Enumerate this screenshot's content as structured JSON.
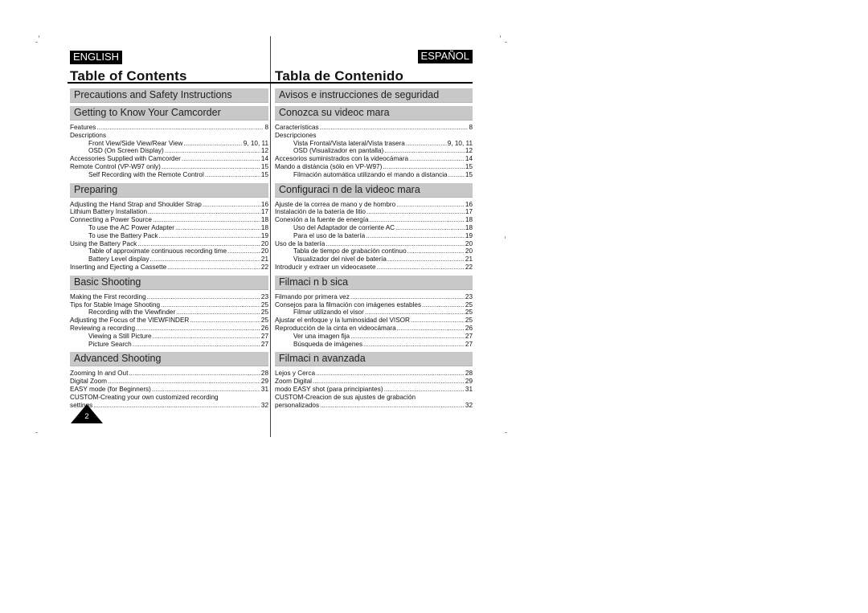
{
  "english": {
    "lang_label": "ENGLISH",
    "title": "Table of Contents",
    "sections": [
      {
        "heading": "Precautions and Safety Instructions",
        "entries": []
      },
      {
        "heading": "Getting to Know Your Camcorder",
        "entries": [
          {
            "label": "Features",
            "page": "8",
            "indent": false
          },
          {
            "label": "Descriptions",
            "page": "",
            "indent": false
          },
          {
            "label": "Front View/Side View/Rear View",
            "page": "9, 10, 11",
            "indent": true
          },
          {
            "label": "OSD (On Screen Display)",
            "page": "12",
            "indent": true
          },
          {
            "label": "Accessories Supplied with Camcorder",
            "page": "14",
            "indent": false
          },
          {
            "label": "Remote Control (VP-W97 only)",
            "page": "15",
            "indent": false
          },
          {
            "label": "Self Recording with the Remote Control",
            "page": "15",
            "indent": true
          }
        ]
      },
      {
        "heading": "Preparing",
        "entries": [
          {
            "label": "Adjusting the Hand Strap and Shoulder Strap",
            "page": "16",
            "indent": false
          },
          {
            "label": "Lithium Battery Installation",
            "page": "17",
            "indent": false
          },
          {
            "label": "Connecting a Power Source",
            "page": "18",
            "indent": false
          },
          {
            "label": "To use the AC Power Adapter",
            "page": "18",
            "indent": true
          },
          {
            "label": "To use the Battery Pack",
            "page": "19",
            "indent": true
          },
          {
            "label": "Using the Battery Pack",
            "page": "20",
            "indent": false
          },
          {
            "label": "Table of approximate continuous recording time",
            "page": "20",
            "indent": true
          },
          {
            "label": "Battery Level display",
            "page": "21",
            "indent": true
          },
          {
            "label": "Inserting and Ejecting a Cassette",
            "page": "22",
            "indent": false
          }
        ]
      },
      {
        "heading": "Basic Shooting",
        "entries": [
          {
            "label": "Making the First recording",
            "page": "23",
            "indent": false
          },
          {
            "label": "Tips for Stable Image Shooting",
            "page": "25",
            "indent": false
          },
          {
            "label": "Recording with the Viewfinder",
            "page": "25",
            "indent": true
          },
          {
            "label": "Adjusting the Focus of the VIEWFINDER",
            "page": "25",
            "indent": false
          },
          {
            "label": "Reviewing a recording",
            "page": "26",
            "indent": false
          },
          {
            "label": "Viewing a Still Picture",
            "page": "27",
            "indent": true
          },
          {
            "label": "Picture Search",
            "page": "27",
            "indent": true
          }
        ]
      },
      {
        "heading": "Advanced Shooting",
        "entries": [
          {
            "label": "Zooming In and Out",
            "page": "28",
            "indent": false
          },
          {
            "label": "Digital Zoom",
            "page": "29",
            "indent": false
          },
          {
            "label": "EASY mode (for Beginners)",
            "page": "31",
            "indent": false
          },
          {
            "label": "CUSTOM-Creating your own customized recording",
            "page": "",
            "indent": false,
            "continued": true
          },
          {
            "label": "settings",
            "page": "32",
            "indent": false
          }
        ]
      }
    ]
  },
  "espanol": {
    "lang_label": "ESPAÑOL",
    "title": "Tabla de Contenido",
    "sections": [
      {
        "heading": "Avisos e instrucciones de seguridad",
        "entries": []
      },
      {
        "heading": "Conozca su videoc mara",
        "entries": [
          {
            "label": "Características",
            "page": "8",
            "indent": false
          },
          {
            "label": "Descripciones",
            "page": "",
            "indent": false
          },
          {
            "label": "Vista Frontal/Vista lateral/Vista trasera",
            "page": "9, 10, 11",
            "indent": true
          },
          {
            "label": "OSD (Visualizador en pantalla)",
            "page": "12",
            "indent": true
          },
          {
            "label": "Accesorios suministrados con la videocámara",
            "page": "14",
            "indent": false
          },
          {
            "label": "Mando a distáncia (sólo en VP-W97)",
            "page": "15",
            "indent": false
          },
          {
            "label": "Filmación automática utilizando el mando a distancia",
            "page": "15",
            "indent": true
          }
        ]
      },
      {
        "heading": "Configuraci n de la videoc mara",
        "entries": [
          {
            "label": "Ajuste de la correa de mano y de hombro",
            "page": "16",
            "indent": false
          },
          {
            "label": "Instalación de la batería de litio",
            "page": "17",
            "indent": false
          },
          {
            "label": "Conexión a la fuente de energía",
            "page": "18",
            "indent": false
          },
          {
            "label": "Uso del Adaptador de corriente AC",
            "page": "18",
            "indent": true
          },
          {
            "label": "Para el uso de la batería",
            "page": "19",
            "indent": true
          },
          {
            "label": "Uso de la batería",
            "page": "20",
            "indent": false
          },
          {
            "label": "Tabla de tiempo de grabación continuo",
            "page": "20",
            "indent": true
          },
          {
            "label": "Visualizador del nivel de batería",
            "page": "21",
            "indent": true
          },
          {
            "label": "Introducir y extraer un videocasete",
            "page": "22",
            "indent": false
          }
        ]
      },
      {
        "heading": "Filmaci n b sica",
        "entries": [
          {
            "label": "Filmando por primera vez",
            "page": "23",
            "indent": false
          },
          {
            "label": "Consejos para la filmación con imágenes estables",
            "page": "25",
            "indent": false
          },
          {
            "label": "Filmar utilizando el visor",
            "page": "25",
            "indent": true
          },
          {
            "label": "Ajustar el enfoque y la luminosidad del VISOR",
            "page": "25",
            "indent": false
          },
          {
            "label": "Reproducción de la cinta en videocámara",
            "page": "26",
            "indent": false
          },
          {
            "label": "Ver una imagen fija",
            "page": "27",
            "indent": true
          },
          {
            "label": "Búsqueda de imágenes",
            "page": "27",
            "indent": true
          }
        ]
      },
      {
        "heading": "Filmaci n avanzada",
        "entries": [
          {
            "label": "Lejos y Cerca",
            "page": "28",
            "indent": false
          },
          {
            "label": "Zoom Digital",
            "page": "29",
            "indent": false
          },
          {
            "label": "modo EASY shot (para principiantes)",
            "page": "31",
            "indent": false
          },
          {
            "label": "CUSTOM-Creacion de sus ajustes de grabación",
            "page": "",
            "indent": false,
            "continued": true
          },
          {
            "label": "personalizados",
            "page": "32",
            "indent": false
          }
        ]
      }
    ]
  },
  "page_number": "2"
}
